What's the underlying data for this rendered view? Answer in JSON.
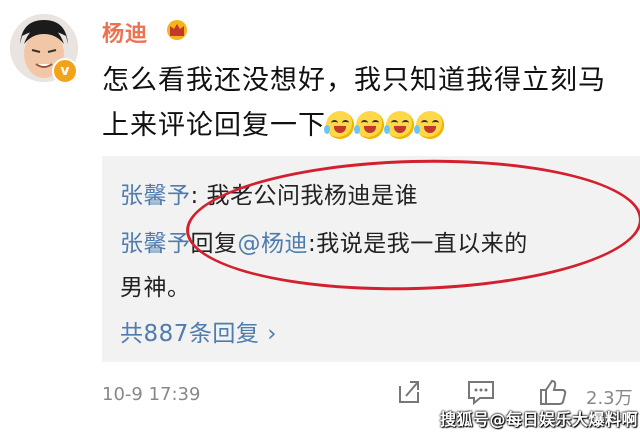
{
  "post": {
    "username": "杨迪",
    "comment_text": "怎么看我还没想好，我只知道我得立刻马上来评论回复一下",
    "emoji_name": "laugh-cry-emoji",
    "emoji_count": 4
  },
  "replies": [
    {
      "user": "张馨予",
      "sep": ":",
      "text": " 我老公问我杨迪是谁"
    },
    {
      "user": "张馨予",
      "action": "回复",
      "mention": "@杨迪",
      "sep": ":",
      "text": "我说是我一直以来的"
    },
    {
      "text": "男神。"
    }
  ],
  "more_replies": "共887条回复 ›",
  "footer": {
    "timestamp": "10-9 17:39",
    "like_count": "2.3万"
  },
  "watermark": "搜狐号@每日娱乐大爆料啊",
  "colors": {
    "username": "#eb7350",
    "link": "#4f7cae",
    "annotation_circle": "#d3202f",
    "reply_bg": "#f2f2f2"
  },
  "icons": [
    "crown-icon",
    "verified-badge-icon",
    "share-icon",
    "comment-icon",
    "like-icon"
  ]
}
